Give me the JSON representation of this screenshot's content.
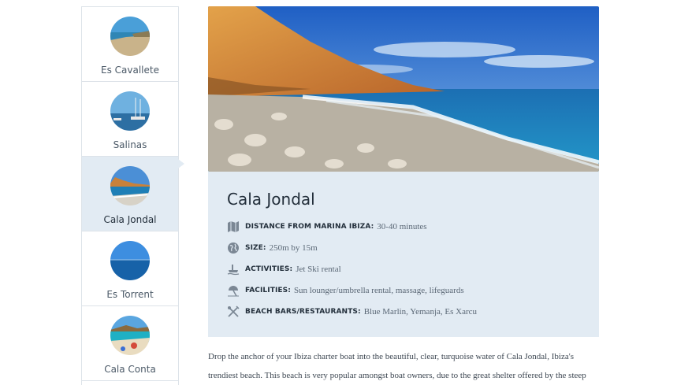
{
  "sidebar": {
    "items": [
      {
        "label": "Es Cavallete"
      },
      {
        "label": "Salinas"
      },
      {
        "label": "Cala Jondal"
      },
      {
        "label": "Es Torrent"
      },
      {
        "label": "Cala Conta"
      }
    ],
    "active": "Cala Jondal"
  },
  "card": {
    "title": "Cala Jondal",
    "rows": [
      {
        "icon": "map-icon",
        "label": "DISTANCE FROM MARINA IBIZA:",
        "value": "30-40 minutes"
      },
      {
        "icon": "globe-icon",
        "label": "SIZE:",
        "value": "250m by 15m"
      },
      {
        "icon": "jet-ski-icon",
        "label": "ACTIVITIES:",
        "value": "Jet Ski rental"
      },
      {
        "icon": "umbrella-icon",
        "label": "FACILITIES:",
        "value": "Sun lounger/umbrella rental, massage, lifeguards"
      },
      {
        "icon": "cutlery-icon",
        "label": "BEACH BARS/RESTAURANTS:",
        "value": "Blue Marlin, Yemanja, Es Xarcu"
      }
    ]
  },
  "description": {
    "line1": "Drop the anchor of your Ibiza charter boat into the beautiful, clear, turquoise water of Cala Jondal, Ibiza's",
    "line2": "trendiest beach. This beach is very popular amongst boat owners, due to the great shelter offered by the steep"
  },
  "colors": {
    "card_bg": "#e2ebf3",
    "title": "#232f3b",
    "border": "#dde3e9"
  }
}
